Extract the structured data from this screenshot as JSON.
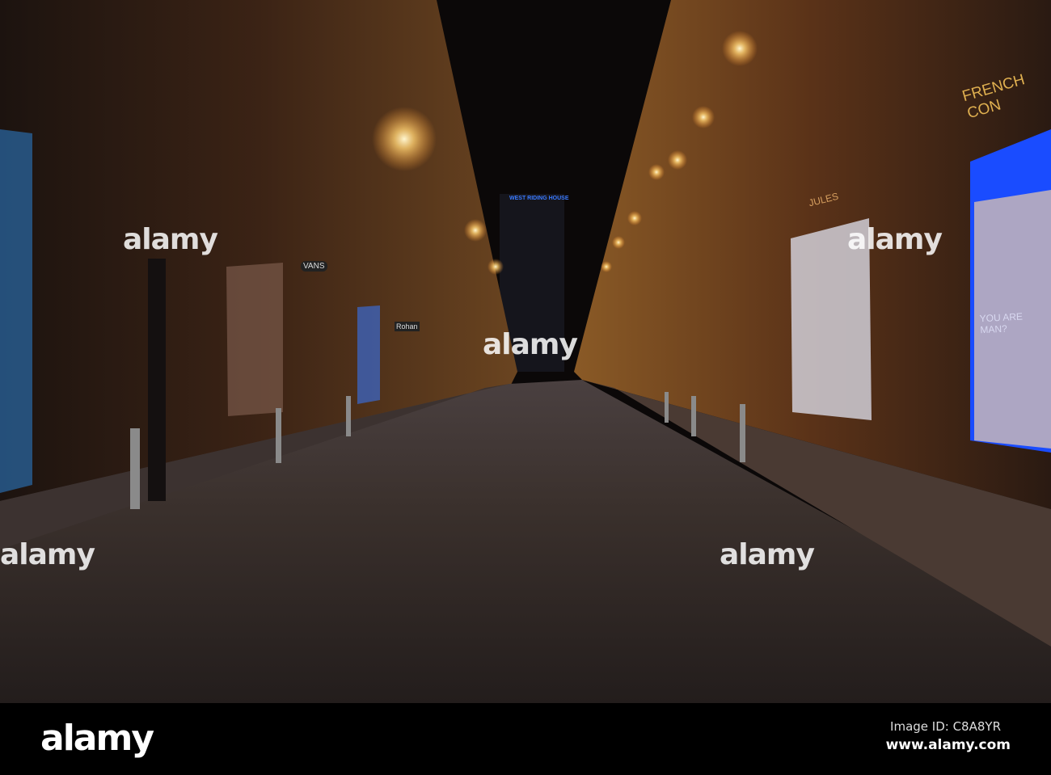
{
  "photo": {
    "tower_sign": "WEST RIDING HOUSE",
    "shop_signs": {
      "french_connection": "FRENCH CON",
      "poster_headline": "YOU ARE MAN?",
      "vans": "VANS",
      "rohan": "Rohan",
      "jules": "JULES"
    },
    "colors": {
      "sky": "#0b0808",
      "facade_left": "#3a2114",
      "facade_right": "#4a2a18",
      "road": "#2a2220",
      "lamp": "#ffd98a",
      "blue_window": "#1a4cff"
    }
  },
  "watermark": {
    "text": "alamy"
  },
  "footer": {
    "logo": "alamy",
    "image_id": "Image ID: C8A8YR",
    "url": "www.alamy.com"
  }
}
